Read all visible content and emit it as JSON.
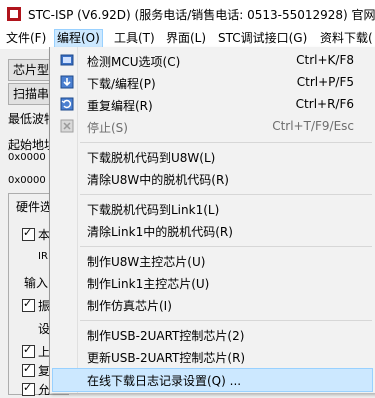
{
  "window": {
    "title": "STC-ISP (V6.92D) (服务电话/销售电话: 0513-55012928) 官网:w"
  },
  "menubar": [
    {
      "label": "文件(F)",
      "active": false
    },
    {
      "label": "编程(O)",
      "active": true
    },
    {
      "label": "工具(T)",
      "active": false
    },
    {
      "label": "界面(L)",
      "active": false
    },
    {
      "label": "STC调试接口(G)",
      "active": false
    },
    {
      "label": "资料下载(",
      "active": false
    }
  ],
  "left_panel": {
    "chip_type_button": "芯片型",
    "scan_button": "扫描串",
    "min_baud_label": "最低波特",
    "start_addr_label": "起始地址",
    "start_addr_value": "0x0000",
    "second_addr_value": "0x0000",
    "hw_tab": "硬件选",
    "row1": "本",
    "row2": "IR",
    "row3": "输入I",
    "row4": "振",
    "row5": "设",
    "row6": "上",
    "row7": "复",
    "row8": "允"
  },
  "dropdown": {
    "items": [
      {
        "label": "检测MCU选项(C)",
        "shortcut": "Ctrl+K/F8",
        "icon": "check-mcu-icon",
        "disabled": false
      },
      {
        "label": "下载/编程(P)",
        "shortcut": "Ctrl+P/F5",
        "icon": "download-icon",
        "disabled": false
      },
      {
        "label": "重复编程(R)",
        "shortcut": "Ctrl+R/F6",
        "icon": "repeat-program-icon",
        "disabled": false
      },
      {
        "label": "停止(S)",
        "shortcut": "Ctrl+T/F9/Esc",
        "icon": "stop-icon",
        "disabled": true
      },
      {
        "label": "下载脱机代码到U8W(L)",
        "shortcut": "",
        "disabled": false
      },
      {
        "label": "清除U8W中的脱机代码(R)",
        "shortcut": "",
        "disabled": false
      },
      {
        "label": "下载脱机代码到Link1(L)",
        "shortcut": "",
        "disabled": false
      },
      {
        "label": "清除Link1中的脱机代码(R)",
        "shortcut": "",
        "disabled": false
      },
      {
        "label": "制作U8W主控芯片(U)",
        "shortcut": "",
        "disabled": false
      },
      {
        "label": "制作Link1主控芯片(U)",
        "shortcut": "",
        "disabled": false
      },
      {
        "label": "制作仿真芯片(I)",
        "shortcut": "",
        "disabled": false
      },
      {
        "label": "制作USB-2UART控制芯片(2)",
        "shortcut": "",
        "disabled": false
      },
      {
        "label": "更新USB-2UART控制芯片(R)",
        "shortcut": "",
        "disabled": false
      },
      {
        "label": "在线下载日志记录设置(Q) ...",
        "shortcut": "",
        "disabled": false,
        "highlighted": true
      }
    ]
  },
  "colors": {
    "highlight": "#cce8ff",
    "highlight_border": "#99d1ff",
    "app_icon": "#b0141c"
  }
}
